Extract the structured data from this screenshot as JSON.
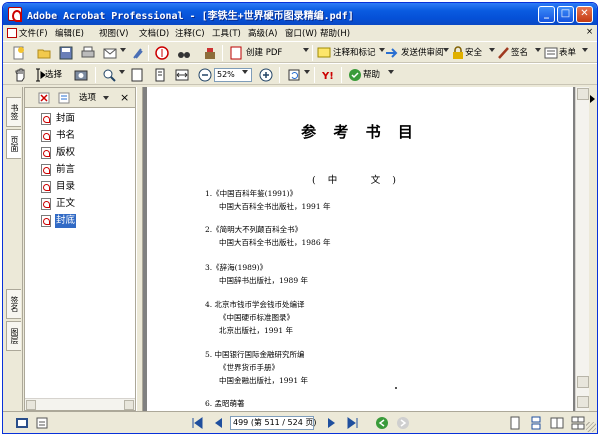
{
  "window": {
    "title": "Adobe Acrobat Professional - [李铁生+世界硬币图录精编.pdf]",
    "minimize": "_",
    "maximize": "□",
    "close": "✕"
  },
  "menu": [
    {
      "label": "文件(F)"
    },
    {
      "label": "编辑(E)"
    },
    {
      "label": "视图(V)"
    },
    {
      "label": "文档(D)"
    },
    {
      "label": "注释(C)"
    },
    {
      "label": "工具(T)"
    },
    {
      "label": "高级(A)"
    },
    {
      "label": "窗口(W)"
    },
    {
      "label": "帮助(H)"
    }
  ],
  "menu_close": "×",
  "toolbar1": {
    "create_pdf": "创建 PDF",
    "comment_markup": "注释和标记",
    "send_review": "发送供审阅",
    "secure": "安全",
    "sign": "签名",
    "forms": "表单"
  },
  "toolbar2": {
    "select": "选择",
    "zoom": "52%",
    "help": "帮助"
  },
  "bookmarks": {
    "options": "选项",
    "close": "×",
    "items": [
      {
        "label": "封面",
        "selected": false
      },
      {
        "label": "书名",
        "selected": false
      },
      {
        "label": "版权",
        "selected": false
      },
      {
        "label": "前言",
        "selected": false
      },
      {
        "label": "目录",
        "selected": false
      },
      {
        "label": "正文",
        "selected": false
      },
      {
        "label": "封底",
        "selected": true
      }
    ]
  },
  "nav_tabs": {
    "bookmarks": "书签",
    "pages": "页面",
    "signatures": "签名",
    "layers": "图层"
  },
  "document": {
    "title": "参 考 书 目",
    "section": "(中　文)",
    "refs": [
      {
        "line1": "1.《中国百科年鉴(1991)》",
        "line2": "中国大百科全书出版社，1991 年"
      },
      {
        "line1": "2.《简明大不列颠百科全书》",
        "line2": "中国大百科全书出版社，1986 年"
      },
      {
        "line1": "3.《辞海(1989)》",
        "line2": "中国辞书出版社，1989 年"
      },
      {
        "line1": "4. 北京市钱币学会钱币处编译",
        "line2": "《中国硬币标准图录》",
        "line3": "北京出版社，1991 年"
      },
      {
        "line1": "5. 中国银行国际金融研究所编",
        "line2": "《世界货币手册》",
        "line3": "中国金融出版社，1991 年"
      },
      {
        "line1": "6. 孟昭萌著"
      }
    ]
  },
  "status": {
    "page_display": "499 (第 511 / 524 页)"
  },
  "colors": {
    "titlebar": "#0a5be0",
    "selection": "#316ac5",
    "chrome": "#ece9d8",
    "doc_background": "#808080"
  }
}
